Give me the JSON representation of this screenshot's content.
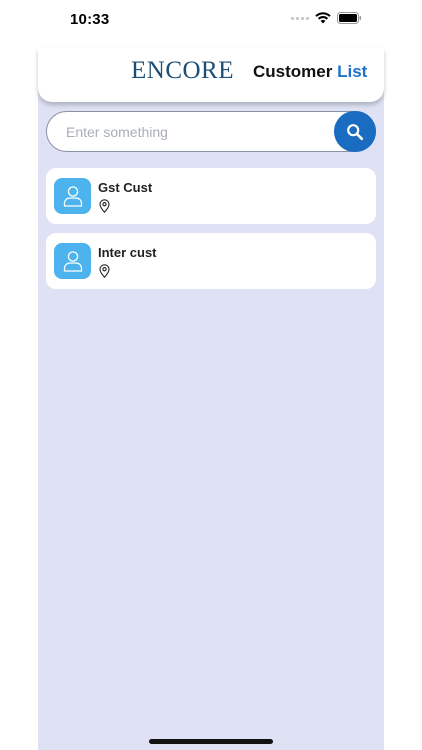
{
  "status_bar": {
    "time": "10:33"
  },
  "header": {
    "logo": "ENCORE",
    "title_main": "Customer",
    "title_accent": "List"
  },
  "search": {
    "placeholder": "Enter something",
    "value": ""
  },
  "customers": [
    {
      "name": "Gst Cust",
      "location": ""
    },
    {
      "name": "Inter cust",
      "location": ""
    }
  ],
  "colors": {
    "accent": "#1a6cc0",
    "avatar": "#4db3ee",
    "background_panel": "#dfe2f4",
    "logo": "#1d4e76"
  },
  "icons": [
    "signal-icon",
    "wifi-icon",
    "battery-icon",
    "search-icon",
    "user-icon",
    "location-pin-icon"
  ]
}
